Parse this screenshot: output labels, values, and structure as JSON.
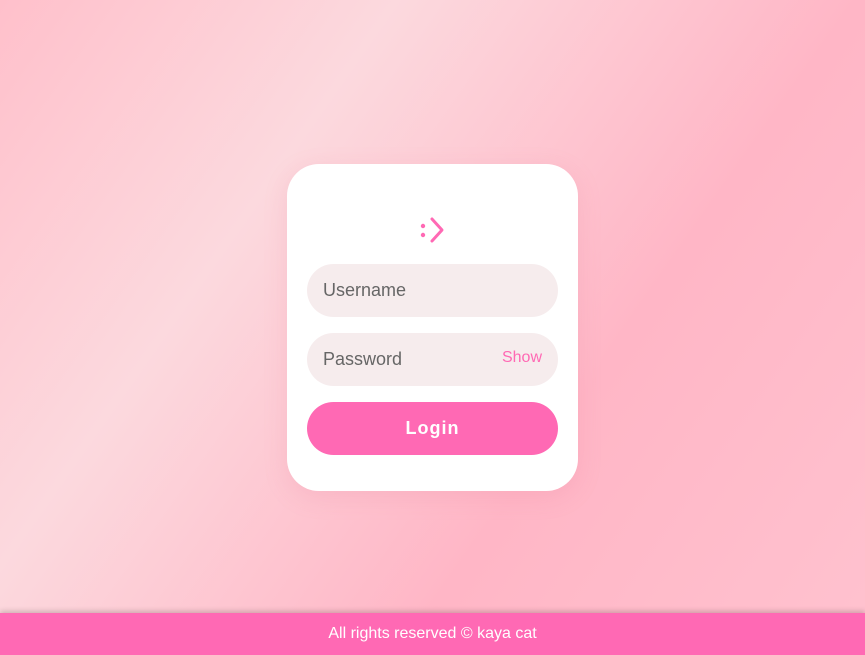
{
  "login": {
    "logo_icon": "colon-chevron-icon",
    "username_placeholder": "Username",
    "password_placeholder": "Password",
    "show_label": "Show",
    "login_label": "Login"
  },
  "footer": {
    "text": "All rights reserved © kaya cat"
  },
  "colors": {
    "accent": "#ff69b4",
    "field_bg": "#f6eced",
    "card_bg": "#ffffff"
  }
}
